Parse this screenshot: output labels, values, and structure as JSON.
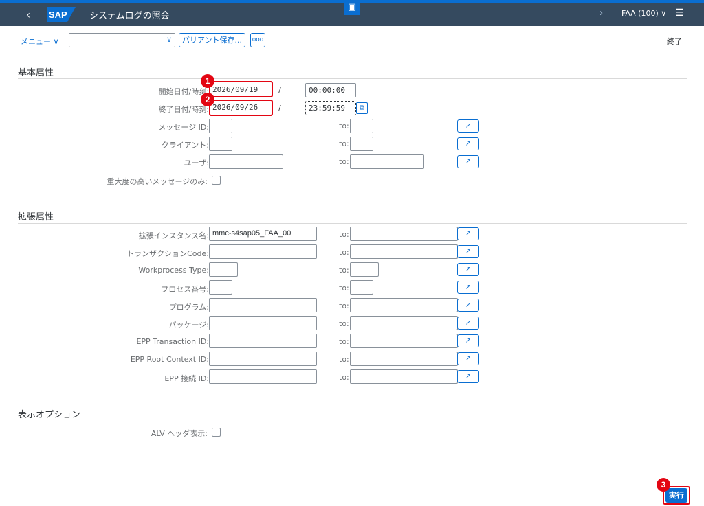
{
  "shell": {
    "back_icon": "chevron-left-icon",
    "logo": "SAP",
    "title": "システムログの照会",
    "chevron": "›",
    "client": "FAA (100) ∨"
  },
  "toolbar": {
    "menu_label": "メニュー ∨",
    "variant_value": "",
    "variant_save": "バリアント保存...",
    "more_label": "ooo",
    "exit_label": "終了"
  },
  "basic": {
    "title": "基本属性",
    "start_label": "開始日付/時刻:",
    "start_date": "2026/09/19",
    "start_time": "00:00:00",
    "end_label": "終了日付/時刻:",
    "end_date": "2026/09/26",
    "end_time": "23:59:59",
    "slash": "/",
    "to": "to:",
    "message_id_label": "メッセージ ID:",
    "client_label": "クライアント:",
    "user_label": "ユーザ:",
    "severity_label": "重大度の高いメッセージのみ:"
  },
  "extended": {
    "title": "拡張属性",
    "instance_label": "拡張インスタンス名:",
    "instance_value": "mmc-s4sap05_FAA_00",
    "tcode_label": "トランザクションCode:",
    "wp_type_label": "Workprocess Type:",
    "process_no_label": "プロセス番号:",
    "program_label": "プログラム:",
    "package_label": "パッケージ:",
    "epp_tx_label": "EPP Transaction ID:",
    "epp_root_label": "EPP Root Context ID:",
    "epp_conn_label": "EPP 接続 ID:"
  },
  "display": {
    "title": "表示オプション",
    "alv_label": "ALV ヘッダ表示:"
  },
  "footer": {
    "execute_label": "実行"
  },
  "annotations": {
    "badge1": "1",
    "badge2": "2",
    "badge3": "3"
  },
  "colors": {
    "shell_bg": "#354a5f",
    "accent": "#0a6ed1",
    "highlight": "#e30613"
  }
}
